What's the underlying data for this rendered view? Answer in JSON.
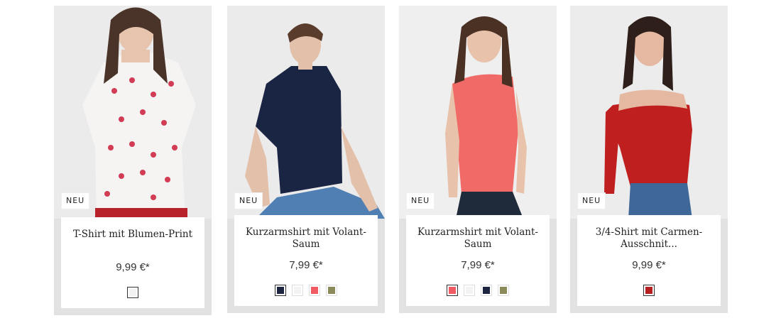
{
  "products": [
    {
      "badge": "NEU",
      "title": "T-Shirt mit Blumen-Print",
      "price": "9,99 €*",
      "swatches": [
        {
          "name": "white-print",
          "color": "#f2f2f2",
          "selected": true
        }
      ]
    },
    {
      "badge": "NEU",
      "title": "Kurzarmshirt mit Volant-Saum",
      "price": "7,99 €*",
      "swatches": [
        {
          "name": "navy",
          "color": "#1c2440",
          "selected": true
        },
        {
          "name": "white",
          "color": "#f3f3f3",
          "selected": false
        },
        {
          "name": "coral",
          "color": "#ef5a63",
          "selected": false
        },
        {
          "name": "khaki",
          "color": "#8a8a5a",
          "selected": false
        }
      ]
    },
    {
      "badge": "NEU",
      "title": "Kurzarmshirt mit Volant-Saum",
      "price": "7,99 €*",
      "swatches": [
        {
          "name": "coral",
          "color": "#ef5a63",
          "selected": true
        },
        {
          "name": "white",
          "color": "#f3f3f3",
          "selected": false
        },
        {
          "name": "navy",
          "color": "#1c2440",
          "selected": false
        },
        {
          "name": "khaki",
          "color": "#8a8a5a",
          "selected": false
        }
      ]
    },
    {
      "badge": "NEU",
      "title": "3/4-Shirt mit Carmen-Ausschnit...",
      "price": "9,99 €*",
      "swatches": [
        {
          "name": "red",
          "color": "#b51f1f",
          "selected": true
        }
      ]
    }
  ]
}
